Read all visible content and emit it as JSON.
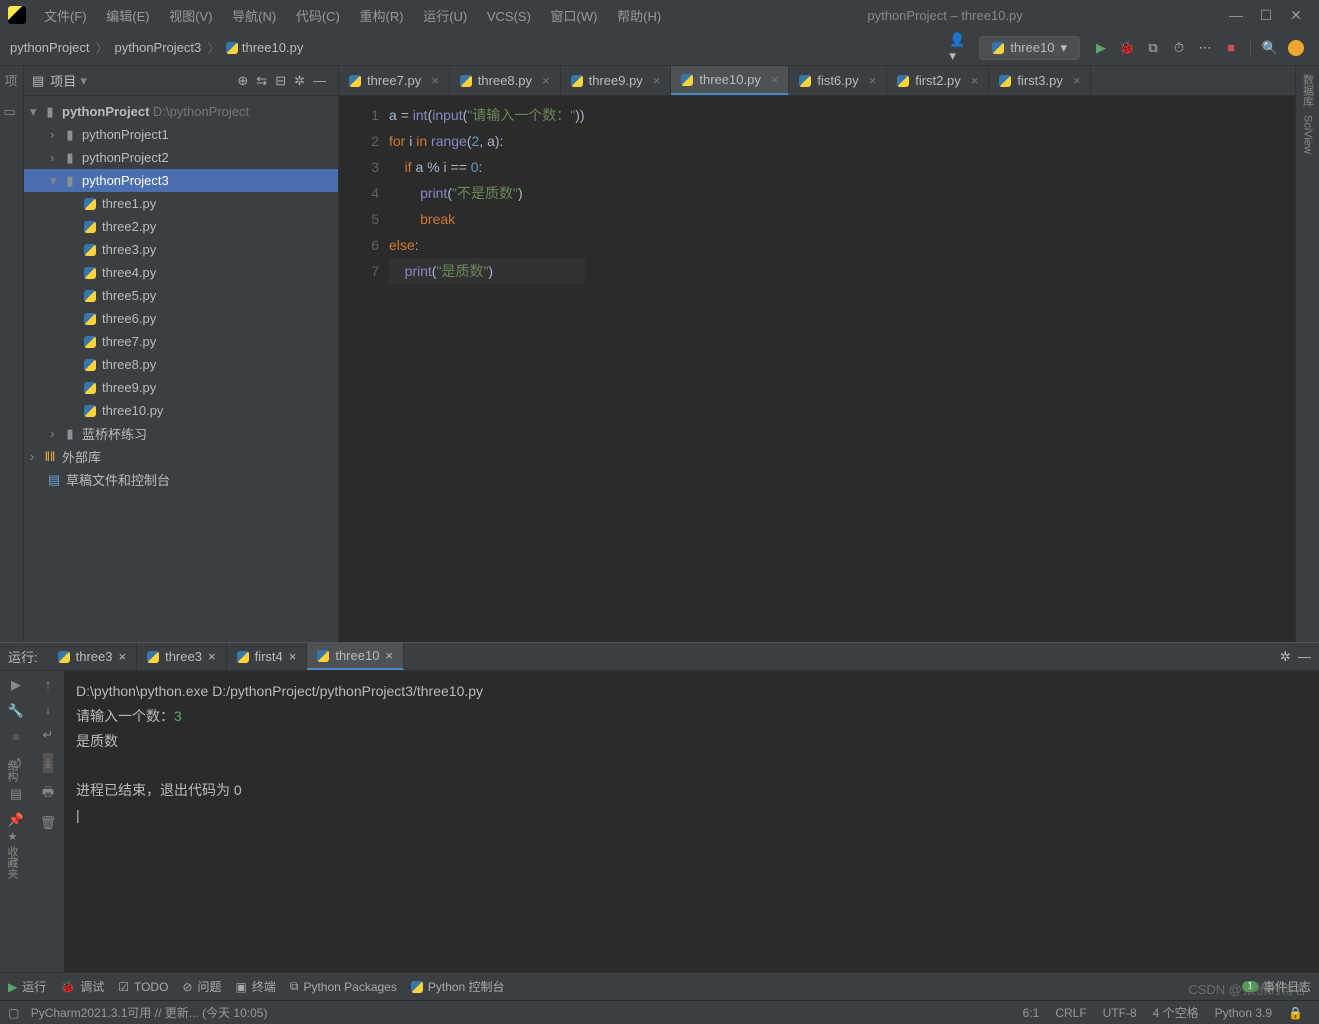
{
  "window": {
    "title": "pythonProject – three10.py",
    "menus": [
      "文件(F)",
      "编辑(E)",
      "视图(V)",
      "导航(N)",
      "代码(C)",
      "重构(R)",
      "运行(U)",
      "VCS(S)",
      "窗口(W)",
      "帮助(H)"
    ]
  },
  "breadcrumbs": [
    "pythonProject",
    "pythonProject3",
    "three10.py"
  ],
  "run_config": "three10",
  "project_panel": {
    "title": "项目",
    "root": {
      "name": "pythonProject",
      "path": "D:\\pythonProject"
    },
    "items": [
      {
        "name": "pythonProject1",
        "depth": 1,
        "type": "dir",
        "expanded": false
      },
      {
        "name": "pythonProject2",
        "depth": 1,
        "type": "dir",
        "expanded": false
      },
      {
        "name": "pythonProject3",
        "depth": 1,
        "type": "dir",
        "expanded": true,
        "selected": true
      },
      {
        "name": "three1.py",
        "depth": 2,
        "type": "py"
      },
      {
        "name": "three2.py",
        "depth": 2,
        "type": "py"
      },
      {
        "name": "three3.py",
        "depth": 2,
        "type": "py"
      },
      {
        "name": "three4.py",
        "depth": 2,
        "type": "py"
      },
      {
        "name": "three5.py",
        "depth": 2,
        "type": "py"
      },
      {
        "name": "three6.py",
        "depth": 2,
        "type": "py"
      },
      {
        "name": "three7.py",
        "depth": 2,
        "type": "py"
      },
      {
        "name": "three8.py",
        "depth": 2,
        "type": "py"
      },
      {
        "name": "three9.py",
        "depth": 2,
        "type": "py"
      },
      {
        "name": "three10.py",
        "depth": 2,
        "type": "py"
      },
      {
        "name": "蓝桥杯练习",
        "depth": 1,
        "type": "dir",
        "expanded": false
      }
    ],
    "extra": [
      {
        "name": "外部库",
        "icon": "library"
      },
      {
        "name": "草稿文件和控制台",
        "icon": "scratch"
      }
    ]
  },
  "editor_tabs": [
    {
      "label": "three7.py"
    },
    {
      "label": "three8.py"
    },
    {
      "label": "three9.py"
    },
    {
      "label": "three10.py",
      "active": true
    },
    {
      "label": "fist6.py"
    },
    {
      "label": "first2.py"
    },
    {
      "label": "first3.py"
    }
  ],
  "code": {
    "lines": [
      "1",
      "2",
      "3",
      "4",
      "5",
      "6",
      "7"
    ],
    "l1": {
      "a": "a ",
      "eq": "= ",
      "int": "int",
      "p1": "(",
      "input": "input",
      "p2": "(",
      "str": "\"请输入一个数：\"",
      "p3": "))"
    },
    "l2": {
      "for": "for ",
      "i": "i ",
      "in": "in ",
      "range": "range",
      "p": "(",
      "n": "2",
      "c": ", a):"
    },
    "l3": {
      "if": "if ",
      "expr": "a % i == ",
      "z": "0",
      ":": ":"
    },
    "l4": {
      "print": "print",
      "p": "(",
      "str": "\"不是质数\"",
      "p2": ")"
    },
    "l5": {
      "break": "break"
    },
    "l6": {
      "else": "else",
      ":": ":"
    },
    "l7": {
      "print": "print",
      "p": "(",
      "str": "\"是质数\"",
      "p2": ")"
    },
    "context": "else"
  },
  "run_panel": {
    "label": "运行:",
    "tabs": [
      {
        "label": "three3"
      },
      {
        "label": "three3"
      },
      {
        "label": "first4"
      },
      {
        "label": "three10",
        "active": true
      }
    ],
    "output": {
      "cmd": "D:\\python\\python.exe D:/pythonProject/pythonProject3/three10.py",
      "prompt": "请输入一个数：",
      "input": "3",
      "result": "是质数",
      "exit": "进程已结束，退出代码为 0"
    }
  },
  "bottom_tools": [
    {
      "icon": "play",
      "label": "运行"
    },
    {
      "icon": "bug",
      "label": "调试"
    },
    {
      "icon": "todo",
      "label": "TODO"
    },
    {
      "icon": "problem",
      "label": "问题"
    },
    {
      "icon": "terminal",
      "label": "终端"
    },
    {
      "icon": "pkg",
      "label": "Python Packages"
    },
    {
      "icon": "pycon",
      "label": "Python 控制台"
    }
  ],
  "event_log": "事件日志",
  "status": {
    "msg": "PyCharm2021.3.1可用 // 更新... (今天 10:05)",
    "pos": "6:1",
    "eol": "CRLF",
    "enc": "UTF-8",
    "spaces": "4 个空格",
    "python": "Python 3.9"
  },
  "watermark": "CSDN @张桥的博客",
  "right_tools": [
    "数据库",
    "SciView"
  ]
}
